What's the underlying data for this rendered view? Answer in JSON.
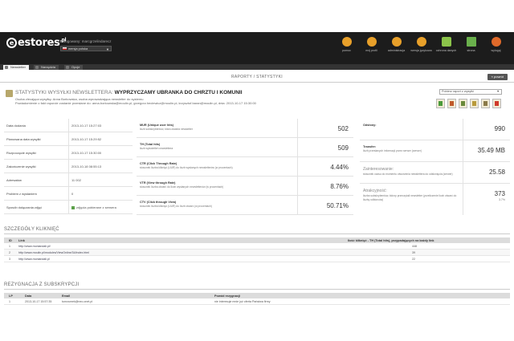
{
  "header": {
    "logo_text": "estores",
    "logo_sup": ".pl",
    "logged_in_label": "Zalogowany: marcgrzelindarecz",
    "language": "wersja polska",
    "nav": [
      {
        "label": "pomoc",
        "icon": "help-icon",
        "color": "#e8a02a"
      },
      {
        "label": "mój profil",
        "icon": "user-icon",
        "color": "#e8a02a"
      },
      {
        "label": "administracja",
        "icon": "users-icon",
        "color": "#e8a02a"
      },
      {
        "label": "wersja językowa",
        "icon": "globe-icon",
        "color": "#e8a02a"
      },
      {
        "label": "ochrona danych",
        "icon": "shield-icon",
        "color": "#8bc34a"
      },
      {
        "label": "strona",
        "icon": "home-icon",
        "color": "#6ab04c"
      },
      {
        "label": "wyloguj",
        "icon": "power-icon",
        "color": "#e06a2a"
      }
    ]
  },
  "tabs": [
    {
      "label": "Newsletter",
      "active": true
    },
    {
      "label": "Narzędzia",
      "active": false
    },
    {
      "label": "Opcje",
      "active": false
    }
  ],
  "page": {
    "title": "RAPORTY / STATYSTYKI",
    "back_label": "« powrót"
  },
  "report": {
    "title_prefix": "STATYSTYKI WYSYŁKI NEWSLETTERA:",
    "title_name": "WYPRZYCZAMY UBRANKA DO CHRZTU I KOMUNII",
    "sub_line1": "Osoba zlecająca wysyłkę: Anna Borkowska, osoba wprowadzająca newsletter do systemu",
    "sub_line2": "Powiadomienie o fakt raporcie zostanie przesłane do: anna.borkowska@moulin.pl, grzegorz.heclewicz@moulin.pl, krzysztof.baran@moulin.pl, dnia: 2013-10-17 15:30:00",
    "select_label": "Pobierz raport z wysyłki",
    "exports": [
      "xls-icon",
      "pdf-icon",
      "csv-icon",
      "html-icon",
      "xml-icon",
      "print-icon"
    ]
  },
  "info_rows": [
    {
      "label": "Data dodania",
      "value": "2013-10-17 15:27:03"
    },
    {
      "label": "Planowana data wysyłki",
      "value": "2013-10-17 15:29:52"
    },
    {
      "label": "Rozpoczęcie wysyłki",
      "value": "2013-10-17 15:30:00"
    },
    {
      "label": "Zakończenie wysyłki",
      "value": "2013-10-18 08:55:13"
    },
    {
      "label": "Adresatów",
      "value": "11 002"
    },
    {
      "label": "Problem z wysłaniem",
      "value": "0"
    },
    {
      "label": "Sposób dołączania zdjęć",
      "value": "zdjęcia pobierane z serwera"
    }
  ],
  "metrics": [
    {
      "title": "MUR (Unique user hits)",
      "desc": "liczb subskrybentów, która otwarła newsletter",
      "value": "502"
    },
    {
      "title": "TH (Total hits)",
      "desc": "liczb wyświetleń newslettera",
      "value": "509"
    },
    {
      "title": "CTR (Click Through Rate)",
      "desc": "stosunek liczba kliknięć (UUR) do liczb wysłanych newsletterów (w procentach)",
      "value": "4.44%"
    },
    {
      "title": "VTR (View through Rate)",
      "desc": "stosunek liczba otwarć do liczb wysłanych newsletterów (w procentach)",
      "value": "8.76%"
    },
    {
      "title": "CTV (Click through View)",
      "desc": "stosunek liczba kliknięć (UUR) do liczb otwarć (w procentach)",
      "value": "50.71%"
    }
  ],
  "transfer": [
    {
      "title": "Odsłony:",
      "desc": "",
      "value": "990",
      "sub": ""
    },
    {
      "title": "Transfer:",
      "desc": "liczb przesłanych informacji przez serwer (serwer)",
      "value": "35.49 MB",
      "sub": ""
    },
    {
      "title": "Zainteresowanie:",
      "desc": "stosunek czasu do momentu otworzenia newslettera do odsłonięcia (serwer)",
      "value": "25.58",
      "sub": ""
    },
    {
      "title": "Atrakcyjność:",
      "desc": "liczba subskrybentów, którzy przeczytali newsletter (przeliczenie liczb otwarć do liczby odbiorców)",
      "value": "373",
      "sub": "3.7%"
    }
  ],
  "clicks": {
    "title": "SZCZEGÓŁY KLIKNIĘĆ",
    "headers": [
      "ID",
      "Link",
      "Ilość kliknięć - TH (Total hits), przypadających na każdy link"
    ],
    "rows": [
      {
        "id": "1",
        "link": "http://www.moniandali.pl/",
        "count": "448"
      },
      {
        "id": "2",
        "link": "http://www.moulin.pl/modules/ViewOnline/34/index.html",
        "count": "39"
      },
      {
        "id": "3",
        "link": "http://www.moniandali.pl",
        "count": "22"
      }
    ]
  },
  "unsub": {
    "title": "REZYGNACJA Z SUBSKRYPCJI",
    "headers": [
      "LP",
      "Data",
      "Email",
      "Powód rezygnacji"
    ],
    "rows": [
      {
        "lp": "1",
        "date": "2013-10-17 15:57:35",
        "email": "tunrzumek@neo.onet.pl",
        "reason": "nie interesuje mnie już oferta Państwa firmy"
      }
    ]
  }
}
